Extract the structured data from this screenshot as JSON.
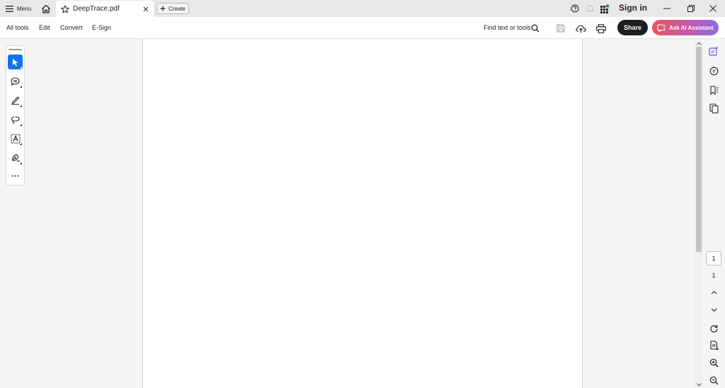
{
  "titlebar": {
    "menu_label": "Menu",
    "tab_title": "DeepTrace.pdf",
    "create_label": "Create",
    "sign_in_label": "Sign in",
    "notification_dot_color": "#1473e6"
  },
  "toolbar": {
    "items": [
      "All tools",
      "Edit",
      "Convert",
      "E-Sign"
    ],
    "find_label": "Find text or tools",
    "share_label": "Share",
    "ai_label": "Ask AI Assistant"
  },
  "left_tools": {
    "tools": [
      "select-icon",
      "comment-icon",
      "highlight-pen-icon",
      "lasso-draw-icon",
      "add-text-icon",
      "sign-pen-icon",
      "more-icon"
    ],
    "active": "select-icon"
  },
  "right_rail": {
    "current_page": "1",
    "total_pages": "1"
  },
  "colors": {
    "accent": "#1473e6",
    "share_bg": "#1e1e1e",
    "ai_gradient_start": "#e8565f",
    "ai_gradient_end": "#8b6ce8"
  }
}
